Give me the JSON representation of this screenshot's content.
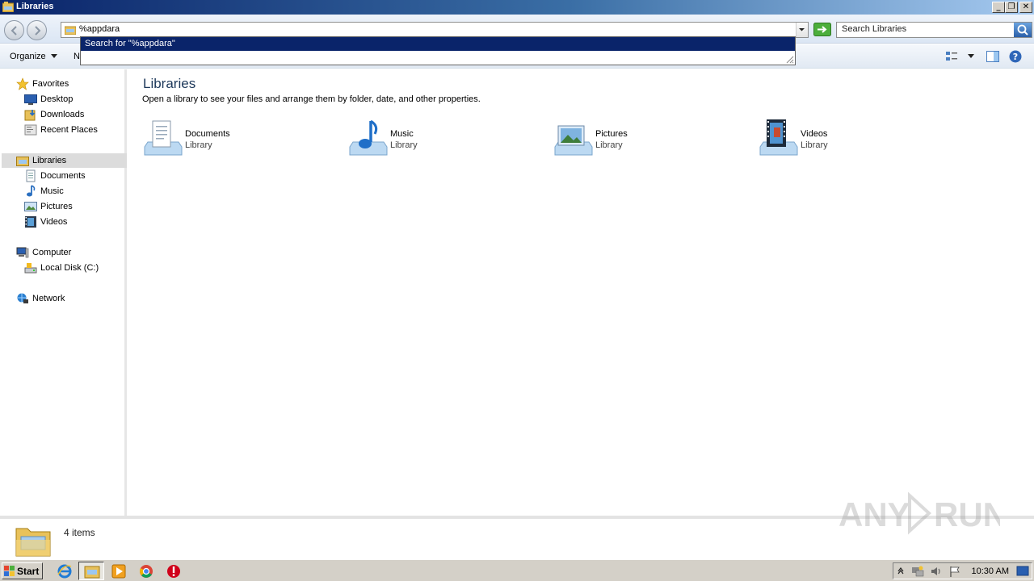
{
  "window": {
    "title": "Libraries",
    "min_glyph": "_",
    "restore_glyph": "❐",
    "close_glyph": "✕"
  },
  "address": {
    "value": "%appdara",
    "autocomplete_suggestion": "Search for \"%appdara\""
  },
  "search": {
    "placeholder": "Search Libraries"
  },
  "toolbar": {
    "organize_label": "Organize",
    "new_label_partial": "N"
  },
  "nav": {
    "favorites": "Favorites",
    "favorites_items": [
      "Desktop",
      "Downloads",
      "Recent Places"
    ],
    "libraries": "Libraries",
    "libraries_items": [
      "Documents",
      "Music",
      "Pictures",
      "Videos"
    ],
    "computer": "Computer",
    "computer_items": [
      "Local Disk (C:)"
    ],
    "network": "Network"
  },
  "content": {
    "title": "Libraries",
    "description": "Open a library to see your files and arrange them by folder, date, and other properties.",
    "libraries": [
      {
        "name": "Documents",
        "sub": "Library",
        "icon": "documents-library-icon"
      },
      {
        "name": "Music",
        "sub": "Library",
        "icon": "music-library-icon"
      },
      {
        "name": "Pictures",
        "sub": "Library",
        "icon": "pictures-library-icon"
      },
      {
        "name": "Videos",
        "sub": "Library",
        "icon": "videos-library-icon"
      }
    ]
  },
  "status": {
    "item_count": "4 items"
  },
  "taskbar": {
    "start_label": "Start",
    "clock": "10:30 AM"
  },
  "watermark": "ANY RUN"
}
